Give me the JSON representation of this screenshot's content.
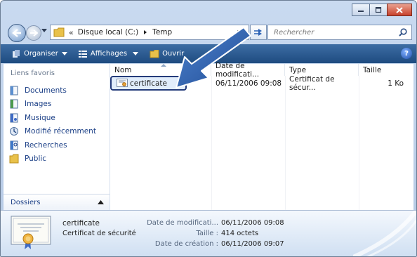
{
  "address": {
    "separator": "«",
    "crumbs": [
      "Disque local (C:)",
      "Temp"
    ],
    "search_placeholder": "Rechercher"
  },
  "toolbar": {
    "organiser": "Organiser",
    "affichages": "Affichages",
    "ouvrir": "Ouvrir",
    "help": "?"
  },
  "navigation": {
    "title": "Liens favoris",
    "items": [
      {
        "label": "Documents",
        "icon": "documents-icon"
      },
      {
        "label": "Images",
        "icon": "images-icon"
      },
      {
        "label": "Musique",
        "icon": "music-icon"
      },
      {
        "label": "Modifié récemment",
        "icon": "recent-icon"
      },
      {
        "label": "Recherches",
        "icon": "search-folder-icon"
      },
      {
        "label": "Public",
        "icon": "folder-icon"
      }
    ],
    "folders_label": "Dossiers"
  },
  "columns": [
    "Nom",
    "Date de modificati...",
    "Type",
    "Taille"
  ],
  "files": [
    {
      "name": "certificate",
      "modified": "06/11/2006 09:08",
      "type": "Certificat de sécur...",
      "size": "1 Ko"
    }
  ],
  "details": {
    "name": "certificate",
    "type": "Certificat de sécurité",
    "fields": [
      {
        "label": "Date de modificati...",
        "value": "06/11/2006 09:08"
      },
      {
        "label": "Taille :",
        "value": "414 octets"
      },
      {
        "label": "Date de création :",
        "value": "06/11/2006 09:07"
      }
    ]
  },
  "colors": {
    "toolbar": "#2a5a93",
    "highlight_border": "#243b7a",
    "link": "#1b3f86",
    "arrow": "#2f5ea8"
  }
}
